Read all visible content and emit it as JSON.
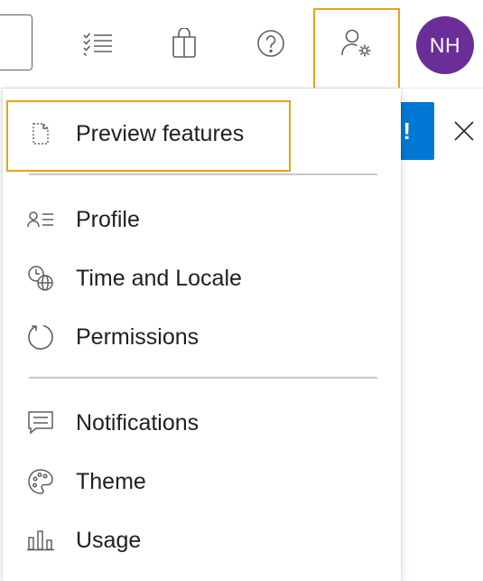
{
  "header": {
    "avatar_initials": "NH",
    "icons": [
      "backlog-list-icon",
      "shopping-bag-icon",
      "help-icon",
      "user-settings-icon"
    ]
  },
  "banner": {
    "button_text": "!",
    "close_icon": "close-icon"
  },
  "menu": {
    "sections": [
      {
        "items": [
          {
            "label": "Preview features",
            "icon": "document-dashed-icon",
            "highlighted": true
          }
        ]
      },
      {
        "items": [
          {
            "label": "Profile",
            "icon": "contact-card-icon"
          },
          {
            "label": "Time and Locale",
            "icon": "clock-globe-icon"
          },
          {
            "label": "Permissions",
            "icon": "refresh-circle-icon"
          }
        ]
      },
      {
        "items": [
          {
            "label": "Notifications",
            "icon": "chat-bubble-icon"
          },
          {
            "label": "Theme",
            "icon": "palette-icon"
          },
          {
            "label": "Usage",
            "icon": "bar-chart-icon"
          }
        ]
      }
    ]
  },
  "colors": {
    "avatar_bg": "#6b2d98",
    "highlight": "#e8a317",
    "primary_button": "#0078d4",
    "text": "#201f1e",
    "icon": "#605e5c"
  }
}
